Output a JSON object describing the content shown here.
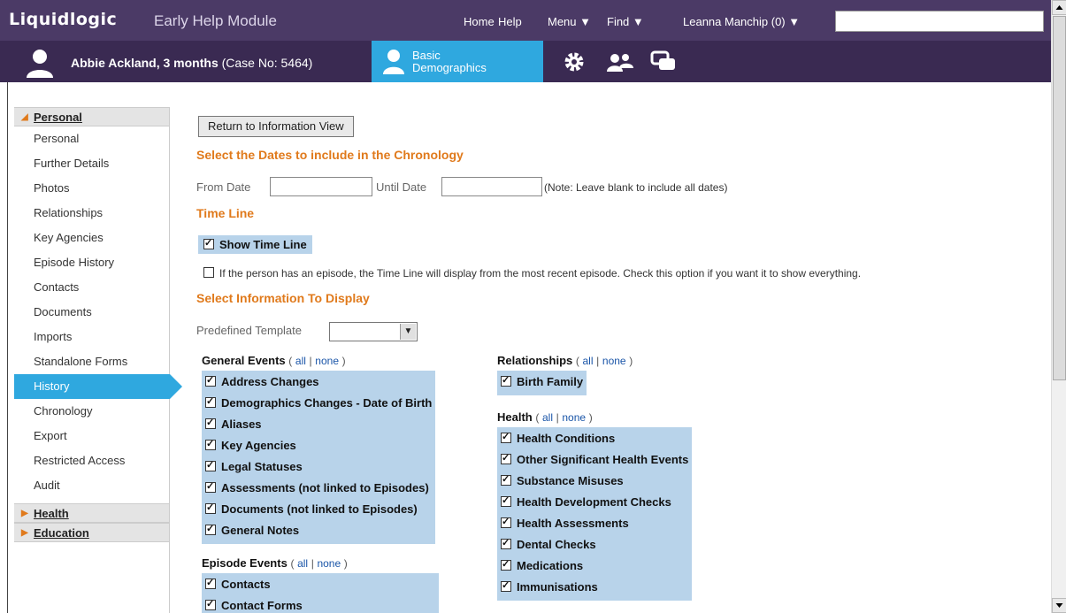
{
  "header": {
    "logo": "Liquidlogic",
    "module": "Early Help Module",
    "nav": {
      "home": "Home",
      "help": "Help",
      "menu": "Menu ▼",
      "find": "Find ▼",
      "user": "Leanna Manchip (0) ▼"
    },
    "search_value": ""
  },
  "case": {
    "name": "Abbie Ackland, 3 months",
    "case_no": "(Case No: 5464)",
    "tab_label_line1": "Basic",
    "tab_label_line2": "Demographics"
  },
  "sidebar": {
    "personal_header": "Personal",
    "items": [
      {
        "label": "Personal"
      },
      {
        "label": "Further Details"
      },
      {
        "label": "Photos"
      },
      {
        "label": "Relationships"
      },
      {
        "label": "Key Agencies"
      },
      {
        "label": "Episode History"
      },
      {
        "label": "Contacts"
      },
      {
        "label": "Documents"
      },
      {
        "label": "Imports"
      },
      {
        "label": "Standalone Forms"
      },
      {
        "label": "History",
        "active": true
      },
      {
        "label": "Chronology"
      },
      {
        "label": "Export"
      },
      {
        "label": "Restricted Access"
      },
      {
        "label": "Audit"
      }
    ],
    "health_header": "Health",
    "education_header": "Education"
  },
  "main": {
    "return_button": "Return to Information View",
    "dates_title": "Select the Dates to include in the Chronology",
    "from_label": "From Date",
    "until_label": "Until Date",
    "from_value": "",
    "until_value": "",
    "dates_note": "(Note: Leave blank to include all dates)",
    "timeline_title": "Time Line",
    "show_timeline_label": "Show Time Line",
    "show_timeline_checked": true,
    "episode_option_label": "If the person has an episode, the Time Line will display from the most recent episode. Check this option if you want it to show everything.",
    "episode_option_checked": false,
    "info_title": "Select Information To Display",
    "template_label": "Predefined Template",
    "template_value": "",
    "link_all": "all",
    "link_none": "none",
    "general_events": {
      "title": "General Events",
      "items": [
        "Address Changes",
        "Demographics Changes - Date of Birth",
        "Aliases",
        "Key Agencies",
        "Legal Statuses",
        "Assessments (not linked to Episodes)",
        "Documents (not linked to Episodes)",
        "General Notes"
      ]
    },
    "episode_events": {
      "title": "Episode Events",
      "items": [
        "Contacts",
        "Contact Forms"
      ]
    },
    "relationships": {
      "title": "Relationships",
      "items": [
        "Birth Family"
      ]
    },
    "health": {
      "title": "Health",
      "items": [
        "Health Conditions",
        "Other Significant Health Events",
        "Substance Misuses",
        "Health Development Checks",
        "Health Assessments",
        "Dental Checks",
        "Medications",
        "Immunisations"
      ]
    }
  }
}
